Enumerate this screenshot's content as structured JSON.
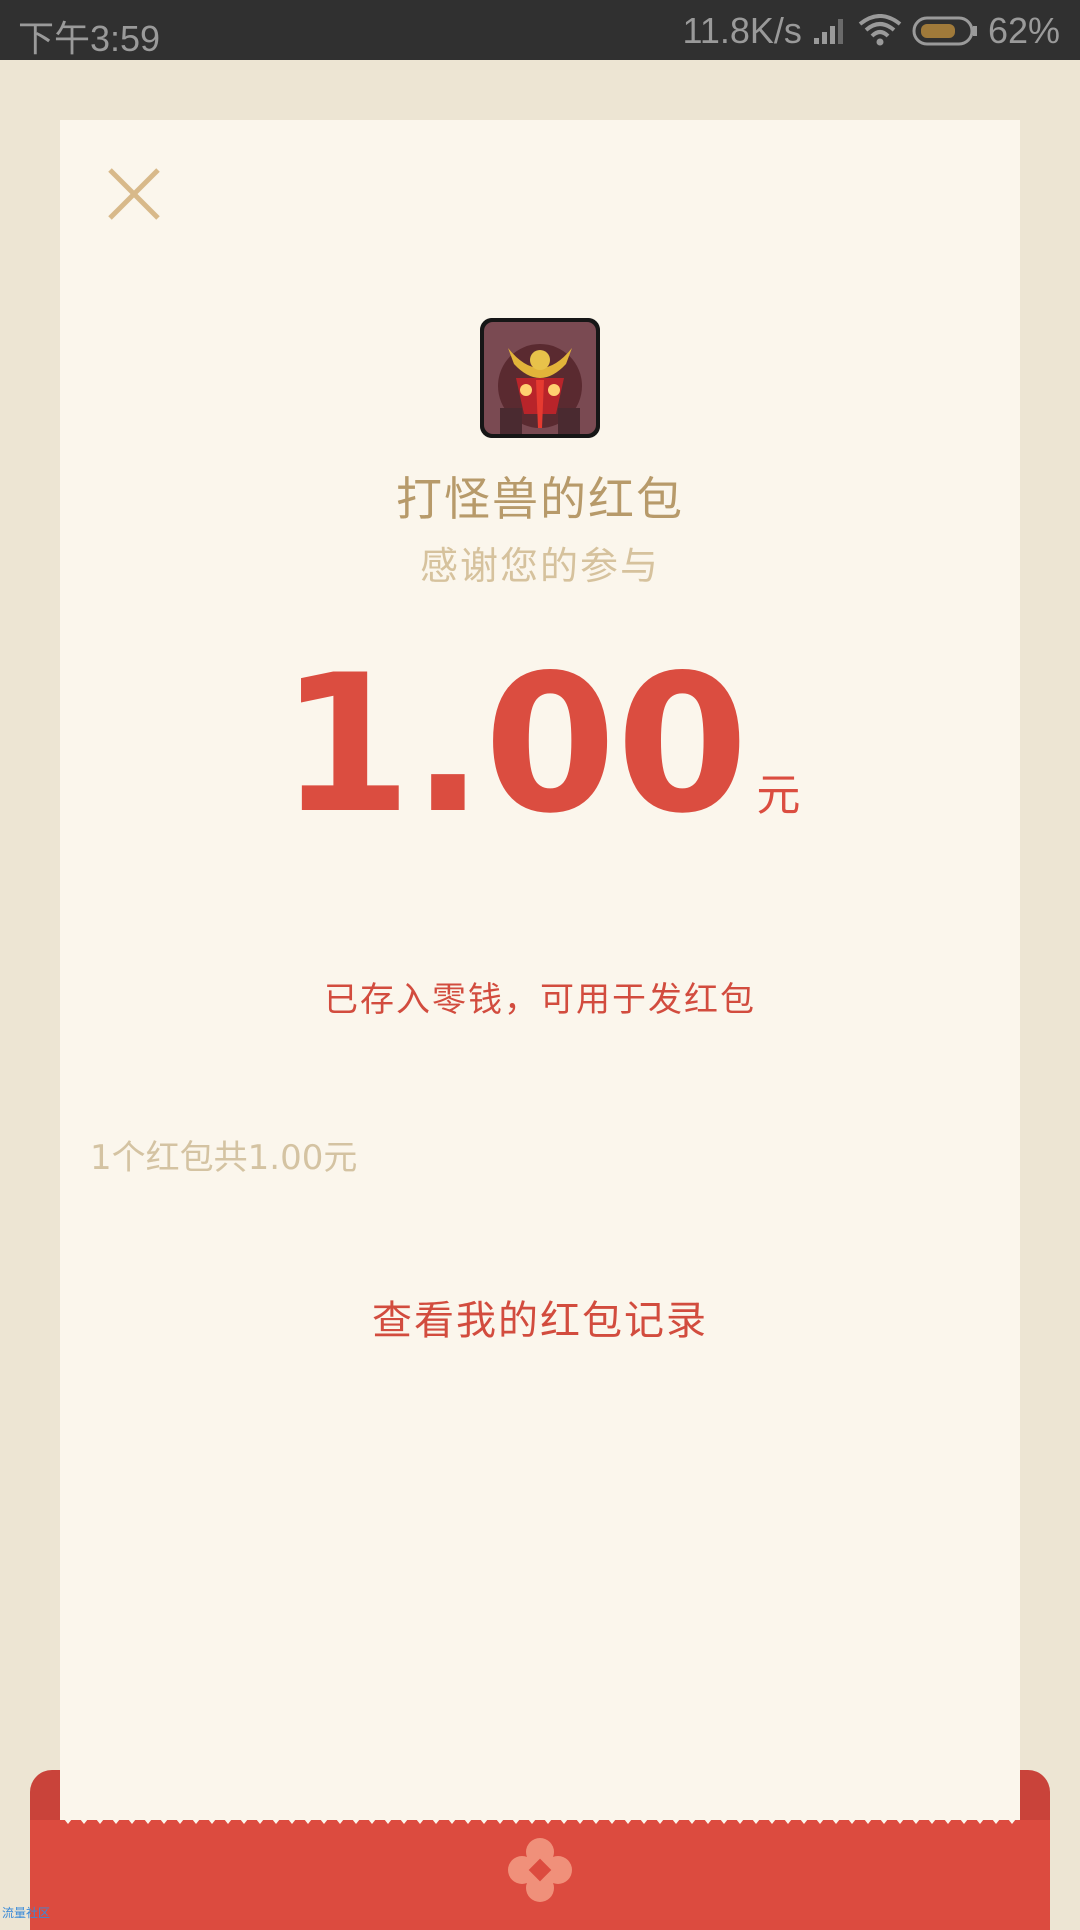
{
  "status_bar": {
    "time": "下午3:59",
    "network_speed": "11.8K/s",
    "battery": "62%"
  },
  "card": {
    "title": "打怪兽的红包",
    "subtitle": "感谢您的参与",
    "amount": "1.00",
    "unit": "元",
    "stored_note": "已存入零钱，可用于发红包",
    "summary": "1个红包共1.00元",
    "history_link": "查看我的红包记录"
  },
  "watermark": "流量社区",
  "icons": {
    "close": "close-icon",
    "avatar": "monster-avatar",
    "flower": "flower-icon"
  },
  "colors": {
    "accent_red": "#db4d40",
    "gold": "#b79a6a",
    "card_bg": "#fbf6ec"
  }
}
